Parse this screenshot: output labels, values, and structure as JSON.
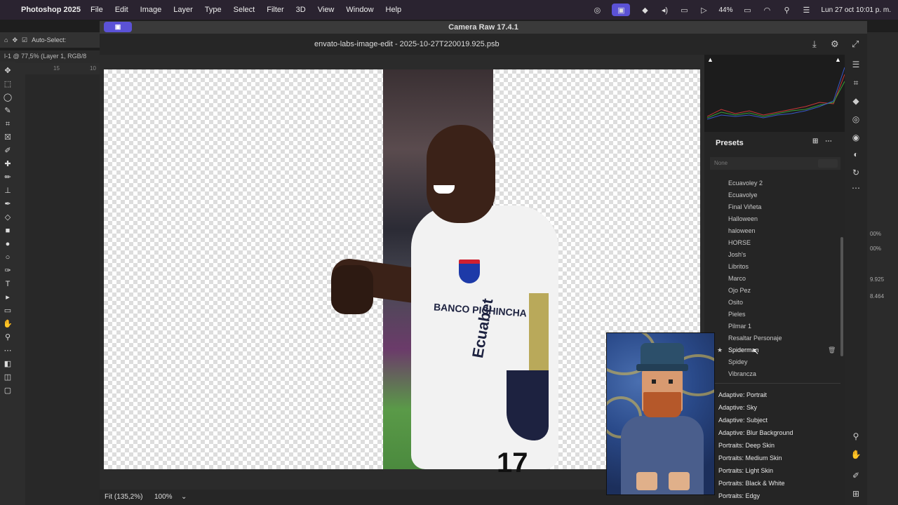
{
  "menubar": {
    "app_name": "Photoshop 2025",
    "items": [
      "File",
      "Edit",
      "Image",
      "Layer",
      "Type",
      "Select",
      "Filter",
      "3D",
      "View",
      "Window",
      "Help"
    ],
    "battery": "44%",
    "datetime": "Lun 27 oct  10:01 p. m."
  },
  "photoshop": {
    "auto_select_label": "Auto-Select:",
    "doc_tab": "l-1 @ 77,5% (Layer 1, RGB/8",
    "ruler_ticks": [
      "15",
      "10"
    ],
    "right_values": [
      "00%",
      "00%",
      "9.925",
      "8.464"
    ]
  },
  "camera_raw": {
    "title": "Camera Raw 17.4.1",
    "filename": "envato-labs-image-edit - 2025-10-27T220019.925.psb",
    "status": {
      "fit": "Fit (135,2%)",
      "zoom": "100%"
    },
    "shirt": {
      "sponsor": "BANCO PICHINCHA",
      "brand": "Ecuabet",
      "number": "17"
    },
    "presets": {
      "header": "Presets",
      "filter_placeholder": "None",
      "user_items": [
        "Ecuavoley 2",
        "Ecuavolye",
        "Final Viñeta",
        "Halloween",
        "haloween",
        "HORSE",
        "Josh's",
        "Libritos",
        "Marco",
        "Ojo Pez",
        "Osito",
        "Pieles",
        "Pilmar 1",
        "Resaltar Personaje",
        "Spiderman",
        "Spidey",
        "Vibrancza"
      ],
      "selected_item": "Spiderman",
      "groups": [
        "Adaptive: Portrait",
        "Adaptive: Sky",
        "Adaptive: Subject",
        "Adaptive: Blur Background",
        "Portraits: Deep Skin",
        "Portraits: Medium Skin",
        "Portraits: Light Skin",
        "Portraits: Black & White",
        "Portraits: Edgy"
      ]
    }
  },
  "icons": {
    "rail": [
      "edit-sliders-icon",
      "crop-icon",
      "eraser-icon",
      "mask-icon",
      "redeye-icon",
      "presets-icon",
      "snapshot-icon",
      "more-icon",
      "zoom-icon",
      "hand-icon",
      "sampler-icon",
      "grid-icon"
    ]
  },
  "colors": {
    "accent": "#5b52d6",
    "panel": "#252525",
    "canvas": "#2b2b2b"
  }
}
